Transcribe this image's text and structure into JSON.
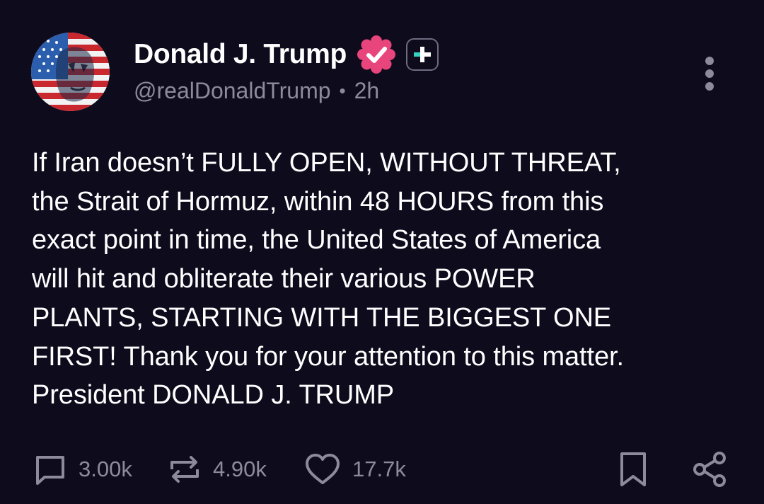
{
  "author": {
    "display_name": "Donald J. Trump",
    "handle": "@realDonaldTrump",
    "separator": "•",
    "time_ago": "2h"
  },
  "post": {
    "text": "If Iran doesn’t FULLY OPEN, WITHOUT THREAT,\nthe Strait of Hormuz, within 48 HOURS from this\nexact point in time, the United States of America\nwill hit and obliterate their various POWER\nPLANTS, STARTING WITH THE BIGGEST ONE\nFIRST! Thank you for your attention to this matter.\nPresident DONALD J. TRUMP"
  },
  "actions": {
    "replies": "3.00k",
    "reposts": "4.90k",
    "likes": "17.7k"
  },
  "icons": {
    "avatar": "flag-portrait-avatar",
    "verified": "verified-badge-icon",
    "plus": "plus-badge-icon",
    "more": "more-vertical-icon",
    "reply": "speech-bubble-icon",
    "repost": "repost-arrows-icon",
    "like": "heart-icon",
    "bookmark": "bookmark-icon",
    "share": "share-icon"
  },
  "colors": {
    "background": "#0e0b1d",
    "text_primary": "#ffffff",
    "text_secondary": "#8d8a9c",
    "verified": "#e8457c",
    "plus_accent": "#35d0c0"
  }
}
